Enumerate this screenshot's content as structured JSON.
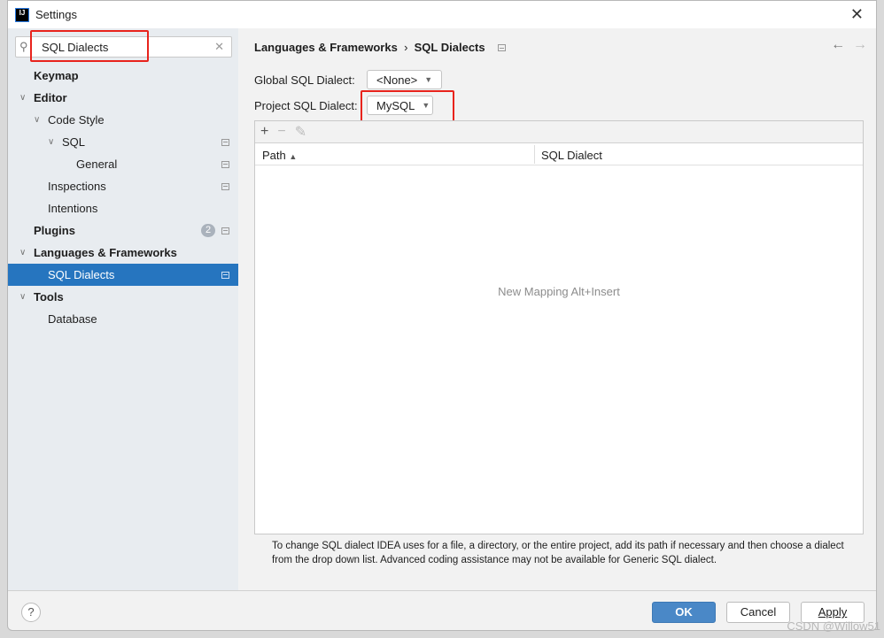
{
  "window": {
    "title": "Settings",
    "close_icon": "close-icon"
  },
  "search": {
    "value": "SQL Dialects"
  },
  "tree": [
    {
      "label": "Keymap",
      "level": 0,
      "bold": true
    },
    {
      "label": "Editor",
      "level": 0,
      "bold": true,
      "expanded": true
    },
    {
      "label": "Code Style",
      "level": 1,
      "expanded": true
    },
    {
      "label": "SQL",
      "level": 2,
      "expanded": true,
      "page_icon": true
    },
    {
      "label": "General",
      "level": 3,
      "page_icon": true
    },
    {
      "label": "Inspections",
      "level": 1,
      "page_icon": true
    },
    {
      "label": "Intentions",
      "level": 1
    },
    {
      "label": "Plugins",
      "level": 0,
      "bold": true,
      "badge": "2",
      "page_icon": true
    },
    {
      "label": "Languages & Frameworks",
      "level": 0,
      "bold": true,
      "expanded": true
    },
    {
      "label": "SQL Dialects",
      "level": 1,
      "selected": true,
      "page_icon": true
    },
    {
      "label": "Tools",
      "level": 0,
      "bold": true,
      "expanded": true
    },
    {
      "label": "Database",
      "level": 1
    }
  ],
  "breadcrumb": {
    "parent": "Languages & Frameworks",
    "separator": "›",
    "current": "SQL Dialects"
  },
  "global_dialect": {
    "label": "Global SQL Dialect:",
    "value": "<None>"
  },
  "project_dialect": {
    "label": "Project SQL Dialect:",
    "value": "MySQL"
  },
  "table": {
    "columns": [
      "Path",
      "SQL Dialect"
    ],
    "sort": "Path ascending",
    "empty_text": "New Mapping Alt+Insert",
    "rows": []
  },
  "help_text": "To change SQL dialect IDEA uses for a file, a directory, or the entire project, add its path if necessary and then choose a dialect from the drop down list. Advanced coding assistance may not be available for Generic SQL dialect.",
  "buttons": {
    "ok": "OK",
    "cancel": "Cancel",
    "apply": "Apply",
    "help": "?"
  },
  "watermark": "CSDN @Willow51",
  "colors": {
    "selection": "#2675bf",
    "ok": "#4a88c7",
    "highlight": "#e8231c"
  }
}
